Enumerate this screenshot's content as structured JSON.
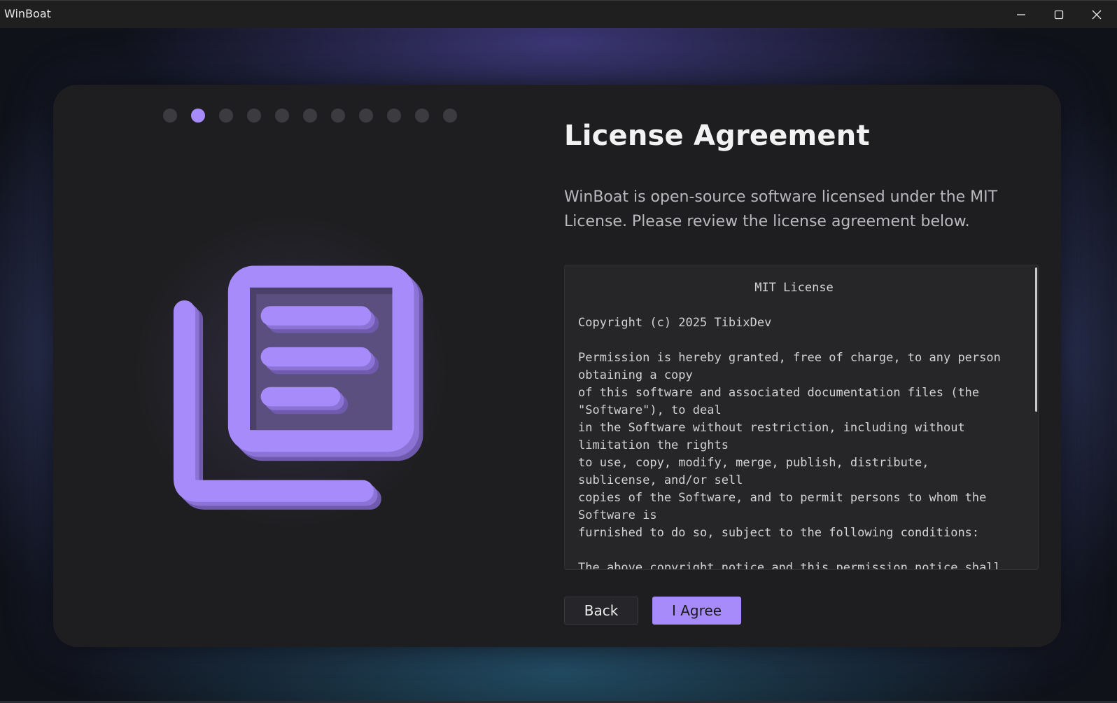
{
  "window": {
    "title": "WinBoat"
  },
  "controls": {
    "minimize_icon": "minimize-icon",
    "maximize_icon": "maximize-icon",
    "close_icon": "close-icon"
  },
  "wizard": {
    "step_count": 11,
    "current_step": 2,
    "accent_color": "#a78bfa",
    "illustration_icon": "document-stack-icon"
  },
  "page": {
    "title": "License Agreement",
    "description": "WinBoat is open-source software licensed under the MIT License. Please review the license agreement below."
  },
  "license": {
    "heading": "MIT License",
    "body": "Copyright (c) 2025 TibixDev\n\nPermission is hereby granted, free of charge, to any person obtaining a copy\nof this software and associated documentation files (the \"Software\"), to deal\nin the Software without restriction, including without limitation the rights\nto use, copy, modify, merge, publish, distribute, sublicense, and/or sell\ncopies of the Software, and to permit persons to whom the Software is\nfurnished to do so, subject to the following conditions:\n\nThe above copyright notice and this permission notice shall"
  },
  "buttons": {
    "back_label": "Back",
    "agree_label": "I Agree"
  }
}
